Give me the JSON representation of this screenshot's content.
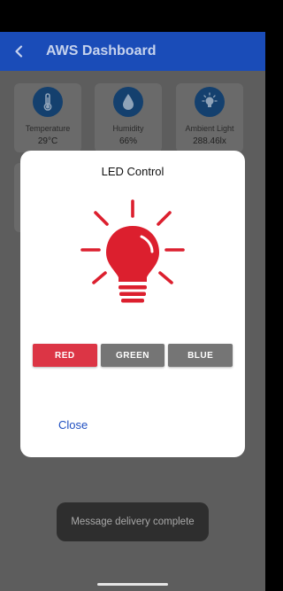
{
  "app_bar": {
    "title": "AWS Dashboard",
    "back_icon": "arrow-left-icon",
    "color": "#1a4cb8"
  },
  "sensors": [
    {
      "label": "Temperature",
      "value": "29°C",
      "icon": "thermometer-icon"
    },
    {
      "label": "Humidity",
      "value": "66%",
      "icon": "water-drop-icon"
    },
    {
      "label": "Ambient Light",
      "value": "288.46lx",
      "icon": "light-bulb-icon"
    }
  ],
  "dialog": {
    "title": "LED Control",
    "bulb_icon": "light-bulb-icon",
    "bulb_color": "#dc1f2e",
    "buttons": [
      {
        "label": "RED",
        "selected": true,
        "color": "#dc3545"
      },
      {
        "label": "GREEN",
        "selected": false,
        "color": "#757575"
      },
      {
        "label": "BLUE",
        "selected": false,
        "color": "#757575"
      }
    ],
    "close_label": "Close"
  },
  "toast": {
    "message": "Message delivery complete"
  }
}
